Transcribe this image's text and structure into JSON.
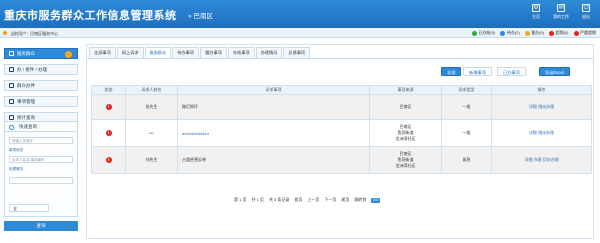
{
  "header": {
    "title": "重庆市服务群众工作信息管理系统",
    "separator": "»",
    "region": "巴南区",
    "buttons": [
      {
        "label": "主页",
        "icon": "gear-icon"
      },
      {
        "label": "我的工作",
        "icon": "mail-icon"
      },
      {
        "label": "退出",
        "icon": "power-icon"
      }
    ]
  },
  "userbar": {
    "welcome": "当前用户：巴南区服务中心",
    "right_items": [
      {
        "label": "已办结(0)",
        "color": "#2cab3d"
      },
      {
        "label": "待办(2)",
        "color": "#2e8ad6"
      },
      {
        "label": "督办(0)",
        "color": "#f5a623"
      },
      {
        "label": "超期(0)",
        "color": "#e2231a"
      },
      {
        "label": "严重超期",
        "color": "#e2231a"
      }
    ]
  },
  "sidebar": {
    "items": [
      {
        "label": "服务群众",
        "active": true
      },
      {
        "label": "办 / 接件 / 办理"
      },
      {
        "label": "群众办件"
      },
      {
        "label": "事项管理"
      },
      {
        "label": "统计查询"
      }
    ],
    "query": {
      "title": "快速查询",
      "input1_placeholder": "请输入关键字",
      "label1": "事项状态",
      "input2_placeholder": "诉求人姓名/事项编号",
      "label2": "处理情况",
      "select_value": "全",
      "button": "查询"
    }
  },
  "tabs": [
    "全部事项",
    "网上诉求",
    "服务群众",
    "待办事项",
    "督办事项",
    "办结事项",
    "办理情况",
    "反馈事项"
  ],
  "active_tab": 2,
  "toolbar": {
    "btn_all": "全部",
    "btn_new": "新增事项",
    "btn_done": "已办事项",
    "btn_export": "导出Excel"
  },
  "table": {
    "headers": [
      "状态",
      "诉求人姓名",
      "诉求事项",
      "事项来源",
      "诉求类型",
      "操作"
    ],
    "rows": [
      {
        "status": "!",
        "name": "张先生",
        "item": "路灯损坏",
        "source": [
          "巴南区"
        ],
        "type": "一般",
        "ops": [
          "详细",
          "指派办理"
        ]
      },
      {
        "status": "!",
        "name": "***",
        "item": "dd4d4d4d4d4d",
        "source": [
          "巴南区",
          "鱼洞街道",
          "龙洲湾社区"
        ],
        "type": "一般",
        "ops": [
          "详细",
          "指派办理"
        ]
      },
      {
        "status": "!",
        "name": "刘先生",
        "item": "占道经营反映",
        "source": [
          "巴南区",
          "鱼洞街道",
          "龙洲湾社区"
        ],
        "type": "紧急",
        "ops": [
          "详细",
          "办理",
          "回访办理"
        ]
      }
    ]
  },
  "pager": {
    "items": [
      "第 1 页",
      "共 1 页",
      "共 3 条记录",
      "首页",
      "上一页",
      "下一页",
      "尾页",
      "跳转到"
    ],
    "go": "GO"
  }
}
